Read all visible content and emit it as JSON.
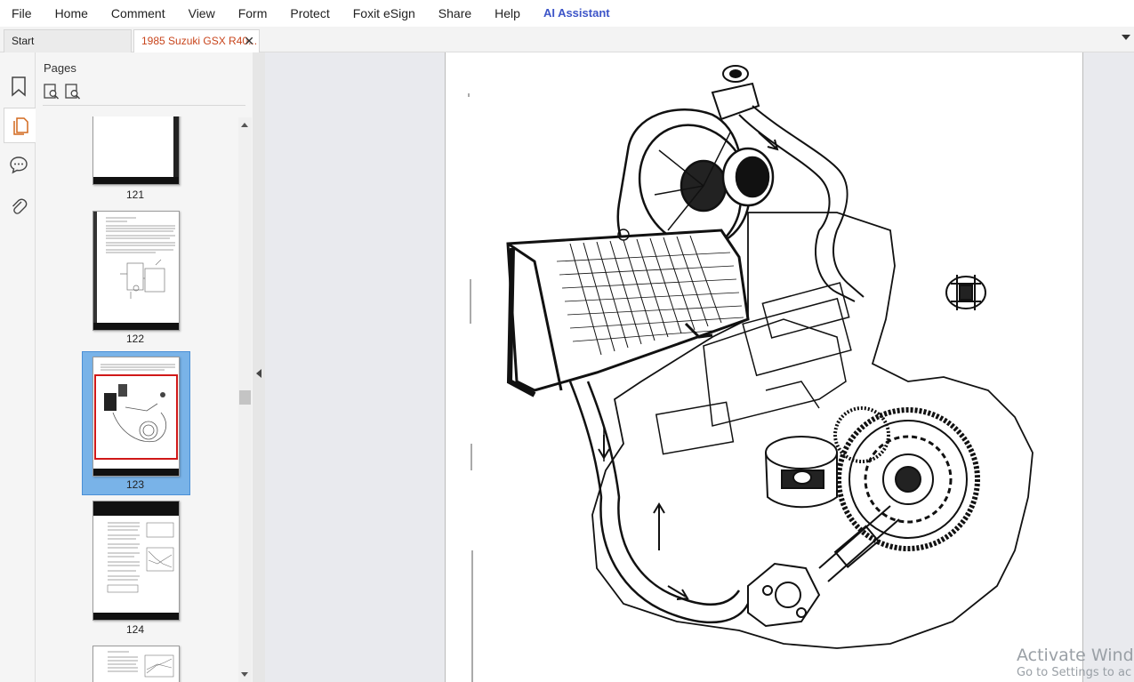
{
  "menu": [
    "File",
    "Home",
    "Comment",
    "View",
    "Form",
    "Protect",
    "Foxit eSign",
    "Share",
    "Help"
  ],
  "ai_assistant": "AI Assistant",
  "tabs": {
    "start": "Start",
    "active": "1985 Suzuki GSX R40..."
  },
  "panel": {
    "title": "Pages"
  },
  "thumbnails": [
    {
      "label": "121"
    },
    {
      "label": "122"
    },
    {
      "label": "123",
      "selected": true
    },
    {
      "label": "124"
    }
  ],
  "watermark": {
    "line1": "Activate Windo",
    "line2": "Go to Settings to ac"
  },
  "colors": {
    "accent": "#c8451c",
    "selection": "#79b3e8",
    "ai": "#3d55c8"
  }
}
